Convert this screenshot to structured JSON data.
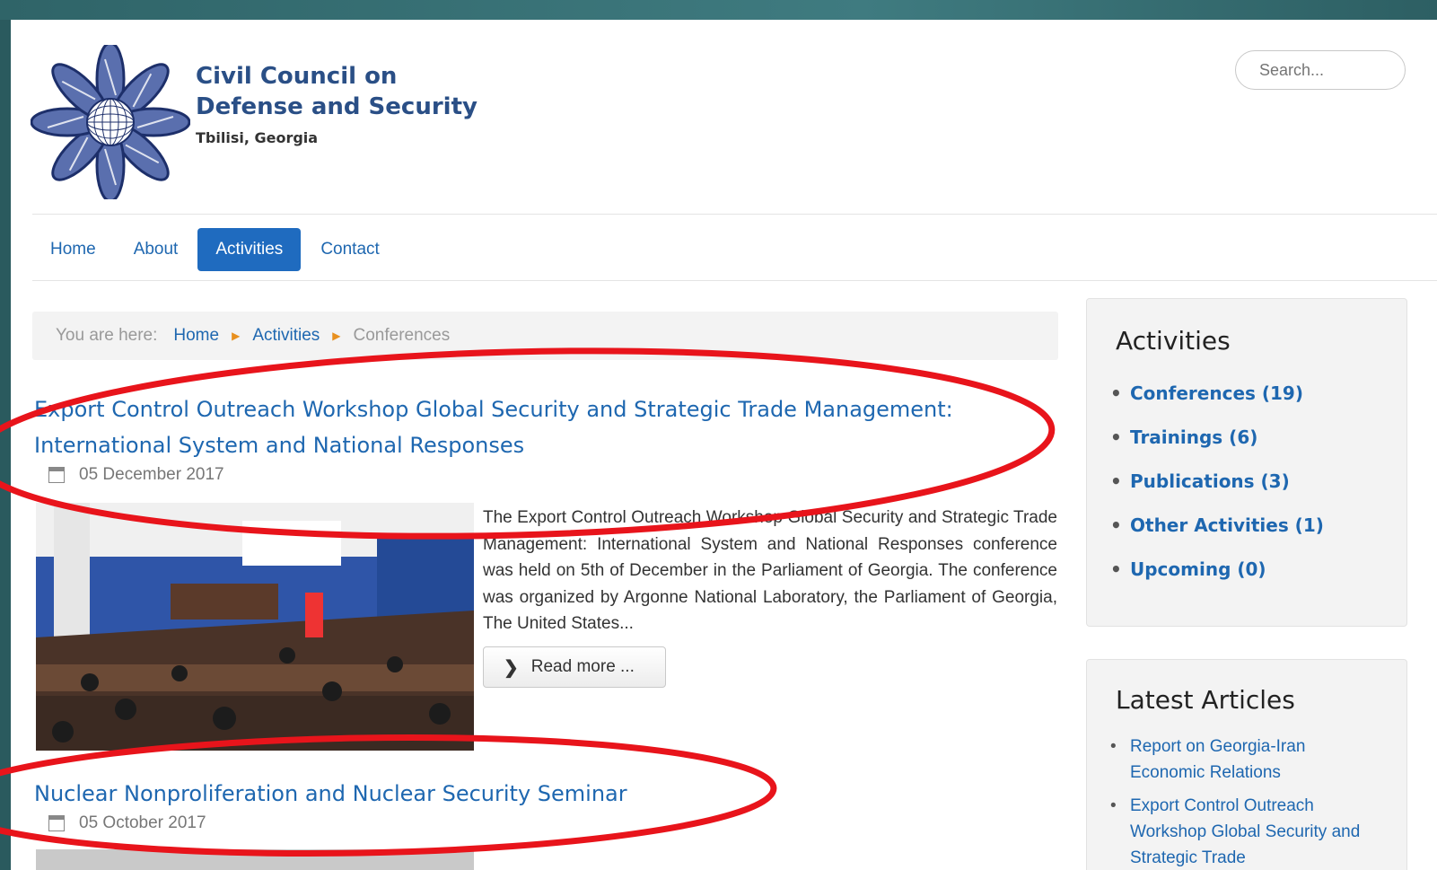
{
  "header": {
    "title_line1": "Civil Council on",
    "title_line2": "Defense and Security",
    "subtitle": "Tbilisi, Georgia",
    "search_placeholder": "Search..."
  },
  "nav": {
    "items": [
      {
        "label": "Home"
      },
      {
        "label": "About"
      },
      {
        "label": "Activities",
        "active": true
      },
      {
        "label": "Contact"
      }
    ]
  },
  "breadcrumb": {
    "prefix": "You are here:",
    "items": [
      "Home",
      "Activities",
      "Conferences"
    ]
  },
  "articles": [
    {
      "title_line1": "Export Control Outreach Workshop Global Security and Strategic Trade Management:",
      "title_line2": "International System and National Responses",
      "date": "05 December 2017",
      "intro": "The Export Control Outreach Workshop Global Security and Strategic Trade Management: International System and National Responses conference was held on 5th of December in the Parliament of Georgia. The conference was organized by Argonne National Laboratory, the Parliament of Georgia, The United States...",
      "read_more": "Read more ..."
    },
    {
      "title": "Nuclear Nonproliferation and Nuclear Security Seminar",
      "date": "05 October 2017"
    }
  ],
  "sidebar": {
    "activities_heading": "Activities",
    "categories": [
      "Conferences (19)",
      "Trainings (6)",
      "Publications (3)",
      "Other Activities (1)",
      "Upcoming (0)"
    ],
    "latest_heading": "Latest Articles",
    "latest": [
      "Report on Georgia-Iran Economic Relations",
      "Export Control Outreach Workshop Global Security and Strategic Trade"
    ]
  },
  "colors": {
    "link": "#1e67b0",
    "active_nav": "#1f6bbf",
    "annotation": "#e8141b",
    "frame": "#2a5a5e"
  },
  "icons": {
    "date": "calendar-icon",
    "read_more": "chevron-right-icon",
    "crumb_sep": "triangle-right-icon"
  }
}
